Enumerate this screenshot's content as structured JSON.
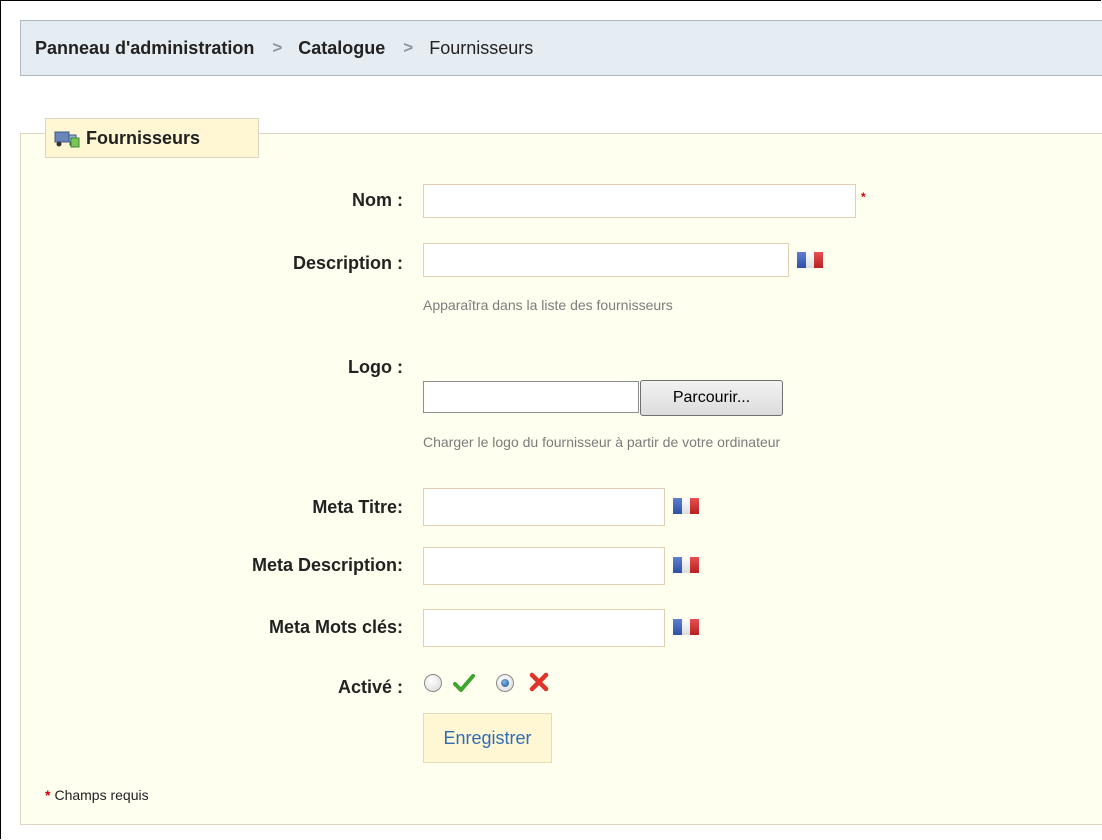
{
  "breadcrumb": {
    "items": [
      "Panneau d'administration",
      "Catalogue",
      "Fournisseurs"
    ],
    "separator": ">"
  },
  "legend": {
    "title": "Fournisseurs",
    "icon": "supplier-truck-icon"
  },
  "form": {
    "name": {
      "label": "Nom :",
      "value": "",
      "required_mark": "*"
    },
    "description": {
      "label": "Description :",
      "value": "",
      "hint": "Apparaîtra dans la liste des fournisseurs",
      "lang_flag": "flag-fr-icon"
    },
    "logo": {
      "label": "Logo :",
      "browse_label": "Parcourir...",
      "hint": "Charger le logo du fournisseur à partir de votre ordinateur"
    },
    "meta_title": {
      "label": "Meta Titre:",
      "value": "",
      "lang_flag": "flag-fr-icon"
    },
    "meta_description": {
      "label": "Meta Description:",
      "value": "",
      "lang_flag": "flag-fr-icon"
    },
    "meta_keywords": {
      "label": "Meta Mots clés:",
      "value": "",
      "lang_flag": "flag-fr-icon"
    },
    "active": {
      "label": "Activé :",
      "yes_icon": "check-icon",
      "no_icon": "cross-icon",
      "selected": "no"
    },
    "submit_label": "Enregistrer"
  },
  "footnote": {
    "star": "*",
    "text": "Champs requis"
  },
  "colors": {
    "breadcrumb_bg": "#e5edf2",
    "fieldset_bg": "#fffff0",
    "legend_bg": "#fff6d3",
    "required": "#cc0000",
    "save_text": "#2f6db3"
  }
}
